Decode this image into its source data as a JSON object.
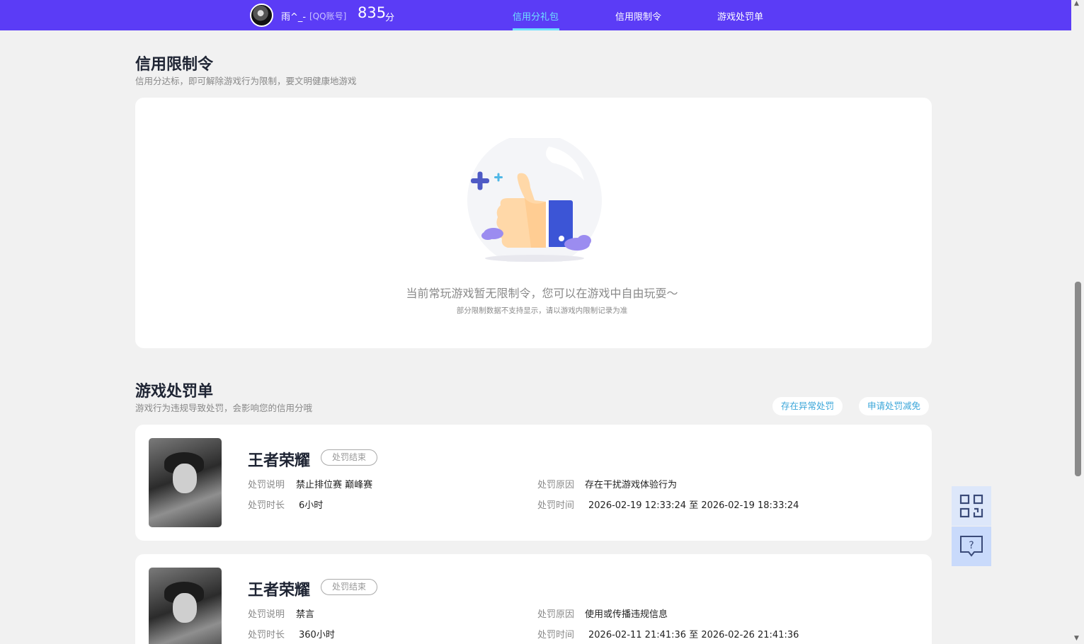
{
  "header": {
    "username": "雨^_-",
    "account_type": "[QQ账号]",
    "score": "835",
    "score_unit": "分",
    "nav": [
      {
        "label": "信用分礼包"
      },
      {
        "label": "信用限制令"
      },
      {
        "label": "游戏处罚单"
      }
    ]
  },
  "restriction": {
    "title": "信用限制令",
    "subtitle": "信用分达标，即可解除游戏行为限制，要文明健康地游戏",
    "empty_message": "当前常玩游戏暂无限制令，您可以在游戏中自由玩耍～",
    "empty_note": "部分限制数据不支持显示，请以游戏内限制记录为准"
  },
  "penalty": {
    "title": "游戏处罚单",
    "subtitle": "游戏行为违规导致处罚，会影响您的信用分哦",
    "abnormal_button": "存在异常处罚",
    "appeal_button": "申请处罚减免",
    "labels": {
      "description": "处罚说明",
      "duration": "处罚时长",
      "reason": "处罚原因",
      "time": "处罚时间"
    },
    "items": [
      {
        "game": "王者荣耀",
        "status": "处罚结束",
        "description": "禁止排位赛 巅峰赛",
        "duration": "6小时",
        "reason": "存在干扰游戏体验行为",
        "time": "2026-02-19 12:33:24 至 2026-02-19 18:33:24"
      },
      {
        "game": "王者荣耀",
        "status": "处罚结束",
        "description": "禁言",
        "duration": "360小时",
        "reason": "使用或传播违规信息",
        "time": "2026-02-11 21:41:36 至 2026-02-26 21:41:36"
      }
    ]
  },
  "icons": {
    "qr": "qr-code-icon",
    "help": "help-chat-icon"
  },
  "colors": {
    "header_bg": "#5b3cf6",
    "nav_active": "#6ee0ff",
    "link": "#3aa6d9"
  }
}
